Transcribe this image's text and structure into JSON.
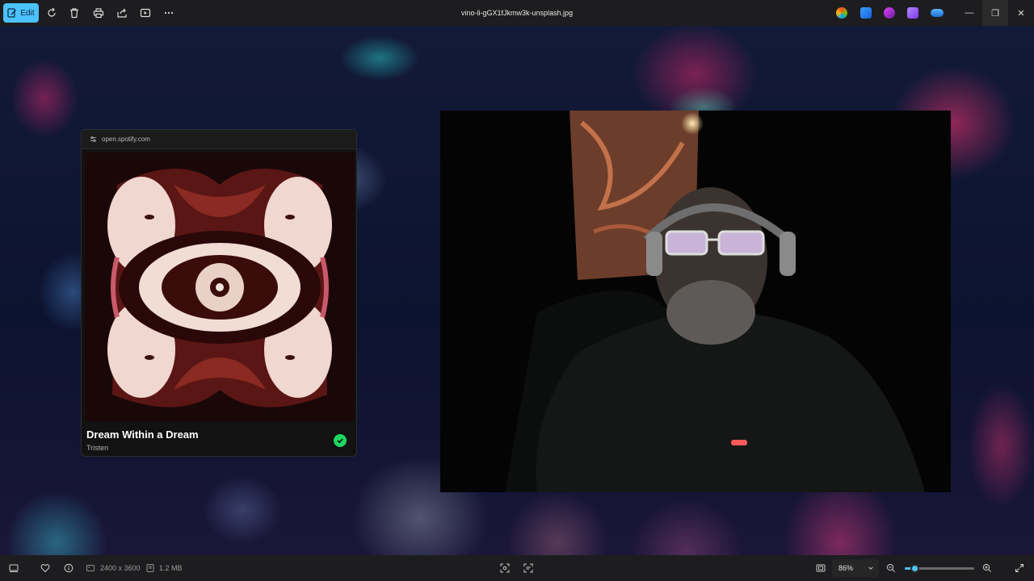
{
  "toolbar": {
    "edit_label": "Edit",
    "file_name": "vino-li-gGX1fJkmw3k-unsplash.jpg",
    "icons": [
      "rotate-icon",
      "delete-icon",
      "print-icon",
      "share-icon",
      "slideshow-icon",
      "more-icon"
    ],
    "app_icons": [
      "copilot-icon",
      "app-blue-icon",
      "app-clipchamp-icon",
      "app-purple-icon",
      "onedrive-icon"
    ],
    "colors": {
      "accent": "#4cc2ff",
      "bar": "#1d1d1f"
    }
  },
  "window_controls": {
    "minimize": "—",
    "restore": "❐",
    "close": "✕"
  },
  "spotify": {
    "url": "open.spotify.com",
    "track": "Dream Within a Dream",
    "artist": "Tristen",
    "saved_color": "#1ed760"
  },
  "status": {
    "dimensions": "2400 x 3600",
    "size": "1.2 MB",
    "zoom": "86%",
    "zoom_fraction": 0.86
  }
}
